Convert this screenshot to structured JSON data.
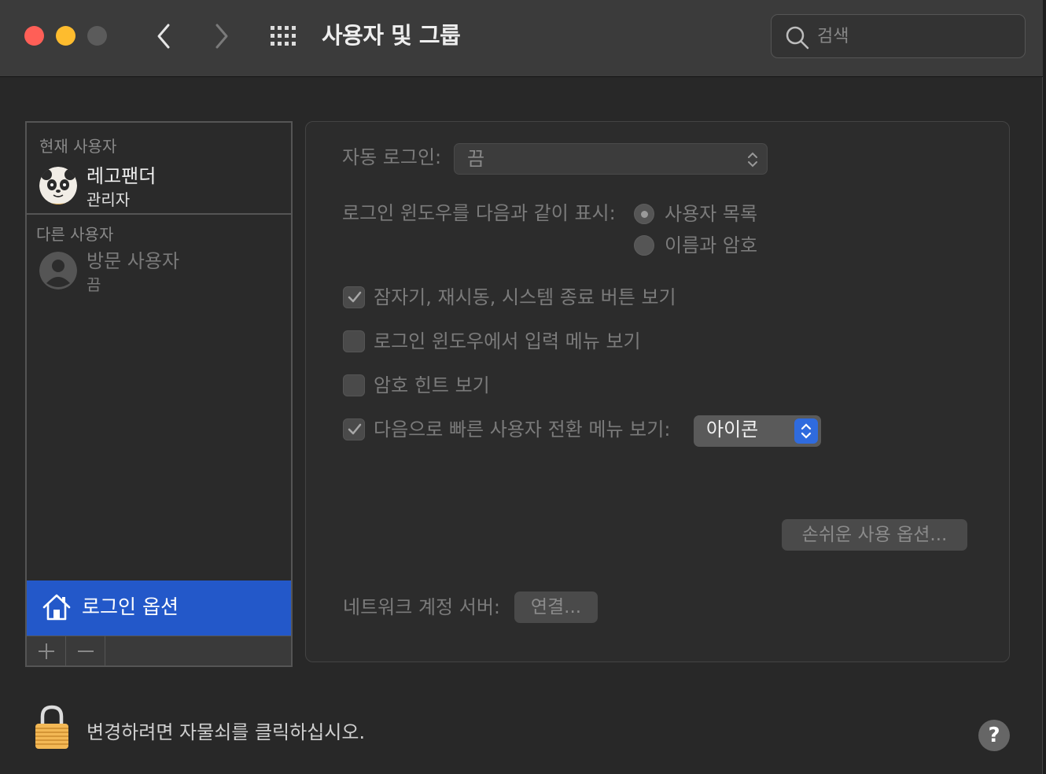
{
  "window": {
    "title": "사용자 및 그룹"
  },
  "toolbar": {
    "search_placeholder": "검색"
  },
  "sidebar": {
    "current_user_label": "현재 사용자",
    "current_user": {
      "name": "레고팬더",
      "role": "관리자"
    },
    "other_users_label": "다른 사용자",
    "other_users": [
      {
        "name": "방문 사용자",
        "status": "끔"
      }
    ],
    "login_options_label": "로그인 옵션"
  },
  "login_options": {
    "auto_login_label": "자동 로그인:",
    "auto_login_value": "끔",
    "display_label": "로그인 윈도우를 다음과 같이 표시:",
    "display_options": [
      {
        "label": "사용자 목록",
        "selected": true
      },
      {
        "label": "이름과 암호",
        "selected": false
      }
    ],
    "checkboxes": [
      {
        "label": "잠자기, 재시동, 시스템 종료 버튼 보기",
        "checked": true
      },
      {
        "label": "로그인 윈도우에서 입력 메뉴 보기",
        "checked": false
      },
      {
        "label": "암호 힌트 보기",
        "checked": false
      },
      {
        "label": "다음으로 빠른 사용자 전환 메뉴 보기:",
        "checked": true
      }
    ],
    "fast_switch_value": "아이콘",
    "accessibility_button": "손쉬운 사용 옵션...",
    "network_server_label": "네트워크 계정 서버:",
    "connect_button": "연결..."
  },
  "footer": {
    "lock_text": "변경하려면 자물쇠를 클릭하십시오.",
    "help_label": "?"
  },
  "colors": {
    "selection": "#2358c9",
    "stepper_accent": "#2f6bde",
    "traffic_red": "#ff5f57",
    "traffic_yellow": "#febc2e"
  }
}
